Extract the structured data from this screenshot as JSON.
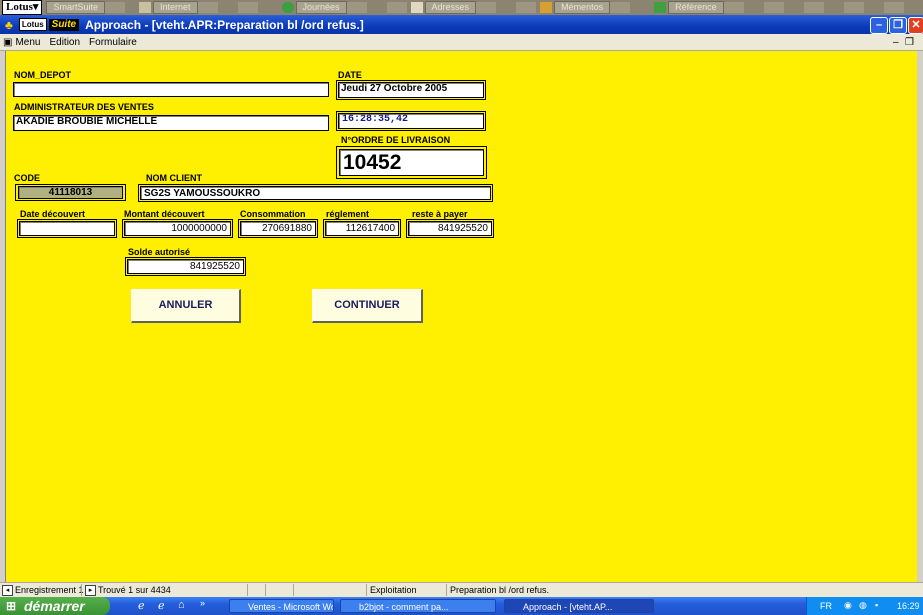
{
  "suitebar": {
    "logo": "Lotus",
    "items": [
      "SmartSuite",
      "Internet",
      "Journées",
      "Adresses",
      "Mémentos",
      "Référence"
    ]
  },
  "window": {
    "suite_logo": "Lotus",
    "suite_name": "Suite",
    "title": "Approach - [vteht.APR:Preparation bl /ord refus.]"
  },
  "menu": {
    "items": [
      "Menu",
      "Edition",
      "Formulaire"
    ]
  },
  "form": {
    "nom_depot": {
      "label": "NOM_DEPOT",
      "value": ""
    },
    "date": {
      "label": "DATE",
      "value": "Jeudi 27 Octobre 2005"
    },
    "administrateur": {
      "label": "ADMINISTRATEUR DES VENTES",
      "value": "AKADIE  BROUBIE MICHELLE"
    },
    "heure": {
      "value": "16:28:35,42"
    },
    "ordre": {
      "label": "N°ORDRE DE LIVRAISON",
      "value": "10452"
    },
    "code": {
      "label": "CODE",
      "value": "41118013"
    },
    "nom_client": {
      "label": "NOM CLIENT",
      "value": "SG2S YAMOUSSOUKRO"
    },
    "date_decouvert": {
      "label": "Date découvert",
      "value": ""
    },
    "montant_decouvert": {
      "label": "Montant découvert",
      "value": "1000000000"
    },
    "consommation": {
      "label": "Consommation",
      "value": "270691880"
    },
    "reglement": {
      "label": "réglement",
      "value": "112617400"
    },
    "reste_a_payer": {
      "label": "reste à payer",
      "value": "841925520"
    },
    "solde_autorise": {
      "label": "Solde autorisé",
      "value": "841925520"
    },
    "annuler_label": "ANNULER",
    "continuer_label": "CONTINUER"
  },
  "status": {
    "record": "Enregistrement 1",
    "found": "Trouvé 1 sur 4434",
    "mode": "Exploitation",
    "view": "Preparation bl /ord refus."
  },
  "taskbar": {
    "start": "démarrer",
    "tasks": [
      "Ventes - Microsoft Word",
      "b2bjot - comment pa...",
      "Approach - [vteht.AP..."
    ],
    "lang": "FR",
    "clock": "16:29"
  },
  "colors": {
    "form_bg": "#ffef00",
    "titlebar": "#0c3ab8",
    "taskbar": "#245ddb",
    "start": "#3a9234"
  }
}
